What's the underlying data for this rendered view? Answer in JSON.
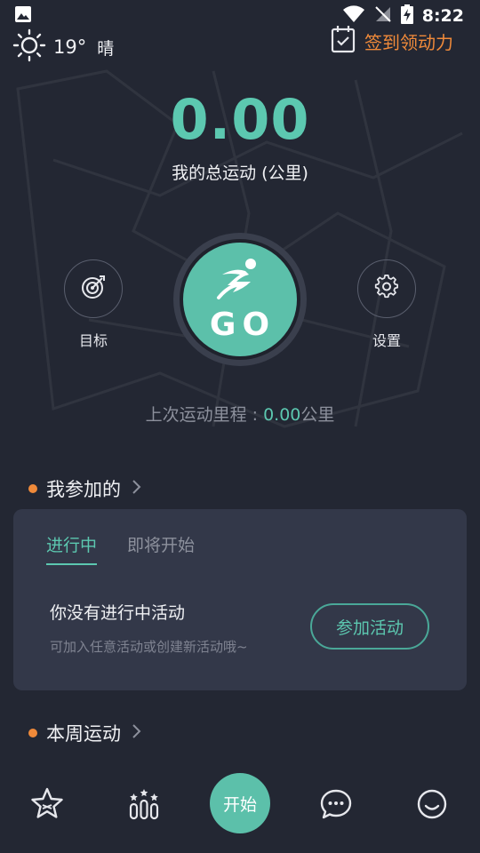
{
  "status_bar": {
    "time": "8:22"
  },
  "weather": {
    "temperature": "19°",
    "condition": "晴"
  },
  "checkin": {
    "label": "签到领动力"
  },
  "summary": {
    "total_distance": "0.00",
    "total_label": "我的总运动 (公里)"
  },
  "actions": {
    "goal_label": "目标",
    "go_label": "GO",
    "settings_label": "设置"
  },
  "last_run": {
    "prefix": "上次运动里程 : ",
    "value": "0.00",
    "unit": "公里"
  },
  "joined": {
    "section_title": "我参加的",
    "tabs": [
      {
        "label": "进行中",
        "active": true
      },
      {
        "label": "即将开始",
        "active": false
      }
    ],
    "empty_title": "你没有进行中活动",
    "empty_subtitle": "可加入任意活动或创建新活动哦~",
    "join_button": "参加活动"
  },
  "weekly": {
    "section_title": "本周运动"
  },
  "bottom_nav": {
    "items": [
      {
        "icon": "star-badge-icon"
      },
      {
        "icon": "ranking-icon"
      },
      {
        "label": "开始"
      },
      {
        "icon": "chat-bubble-icon"
      },
      {
        "icon": "smiley-icon"
      }
    ]
  },
  "colors": {
    "background": "#232733",
    "accent": "#5cc0aa",
    "orange": "#f08a3a",
    "card": "#333849"
  }
}
